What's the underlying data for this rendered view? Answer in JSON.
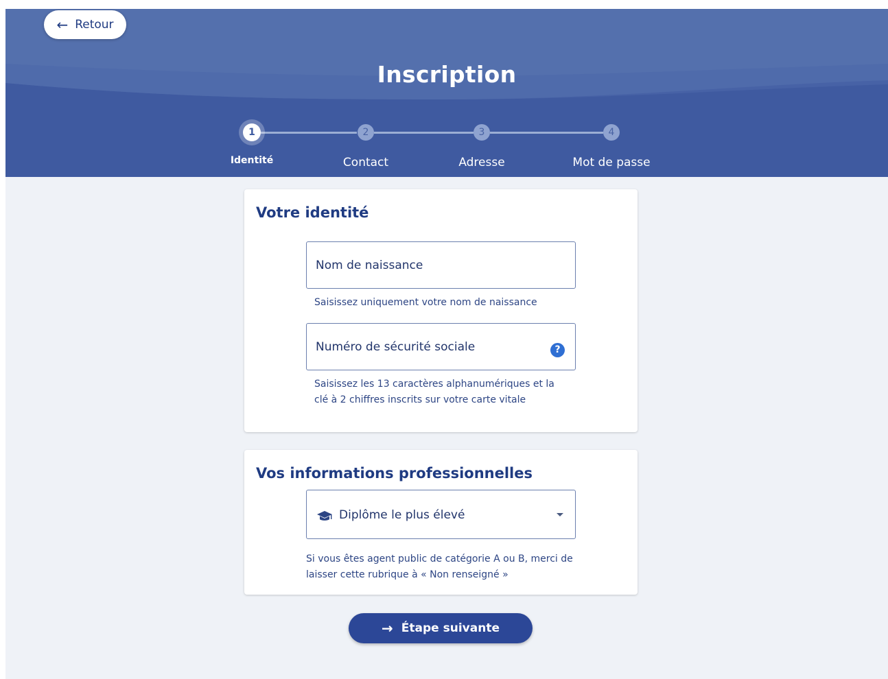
{
  "header": {
    "back_label": "Retour",
    "title": "Inscription"
  },
  "stepper": {
    "current_step": 1,
    "steps": [
      {
        "number": "1",
        "label": "Identité"
      },
      {
        "number": "2",
        "label": "Contact"
      },
      {
        "number": "3",
        "label": "Adresse"
      },
      {
        "number": "4",
        "label": "Mot de passe"
      }
    ]
  },
  "identity_card": {
    "title": "Votre identité",
    "birth_name": {
      "label": "Nom de naissance",
      "hint": "Saisissez uniquement votre nom de naissance"
    },
    "social_security": {
      "label": "Numéro de sécurité sociale",
      "help_icon": "?",
      "hint_line1": "Saisissez les 13 caractères alphanumériques et la",
      "hint_line2": "clé à 2 chiffres inscrits sur votre carte vitale"
    }
  },
  "pro_card": {
    "title": "Vos informations professionnelles",
    "diploma": {
      "icon": "graduation-cap-icon",
      "label": "Diplôme le plus élevé"
    },
    "hint_line1": "Si vous êtes agent public de catégorie A ou B, merci de",
    "hint_line2": "laisser cette rubrique à « Non renseigné »"
  },
  "footer": {
    "next_label": "Étape suivante"
  },
  "colors": {
    "header_bg": "#5470ad",
    "header_wave": "#3f5aa0",
    "primary": "#2c4797",
    "text_dark": "#1f3b82",
    "page_bg": "#eff2f7",
    "help_icon": "#2f6fd3"
  }
}
